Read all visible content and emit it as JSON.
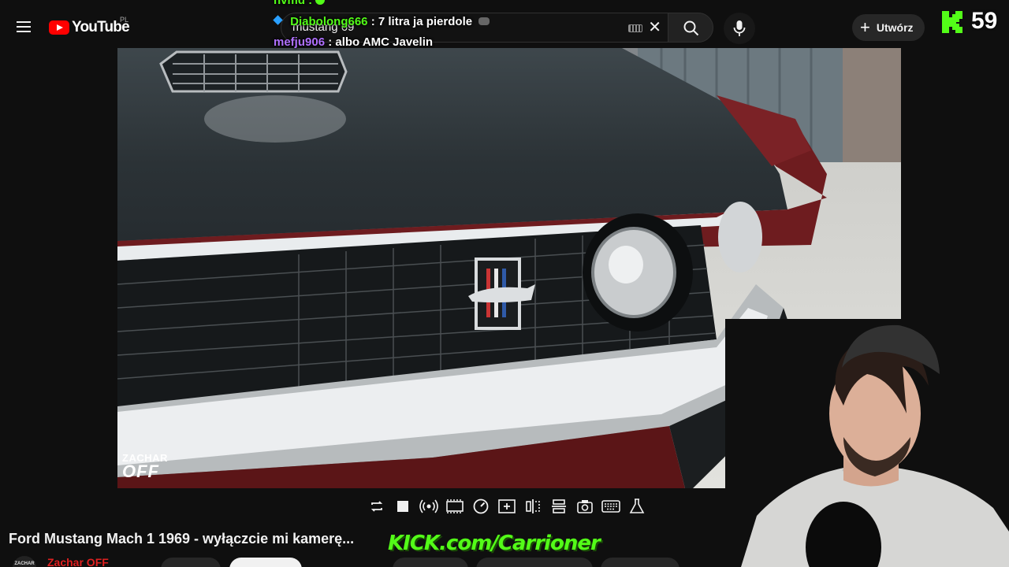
{
  "header": {
    "logo_text": "YouTube",
    "country_code": "PL",
    "search_value": "mustang 69",
    "create_label": "Utwórz"
  },
  "overlay": {
    "viewer_count": "59",
    "chat": {
      "top_partial": "nvmd :",
      "messages": [
        {
          "user": "Diabolong666",
          "text": ": 7 litra ja pierdole",
          "user_color": "#53fc18"
        },
        {
          "user": "mefju906",
          "text": ": albo AMC Javelin",
          "user_color": "#b070ff"
        }
      ]
    },
    "kick_banner": "KICK.com/Carrioner"
  },
  "video": {
    "watermark_top": "ZACHAR",
    "watermark_bottom": "OFF",
    "title": "Ford Mustang Mach 1 1969 - wyłączcie mi kamerę...",
    "channel_name": "Zachar OFF",
    "channel_avatar_text": "ZACHAR"
  },
  "controls": [
    "repeat-icon",
    "stop-icon",
    "broadcast-icon",
    "filmstrip-icon",
    "speedometer-icon",
    "add-box-icon",
    "split-icon",
    "resize-icon",
    "camera-icon",
    "keyboard-icon",
    "flask-icon"
  ],
  "colors": {
    "kick_green": "#53fc18",
    "youtube_red": "#ff0000",
    "background": "#0f0f0f"
  }
}
